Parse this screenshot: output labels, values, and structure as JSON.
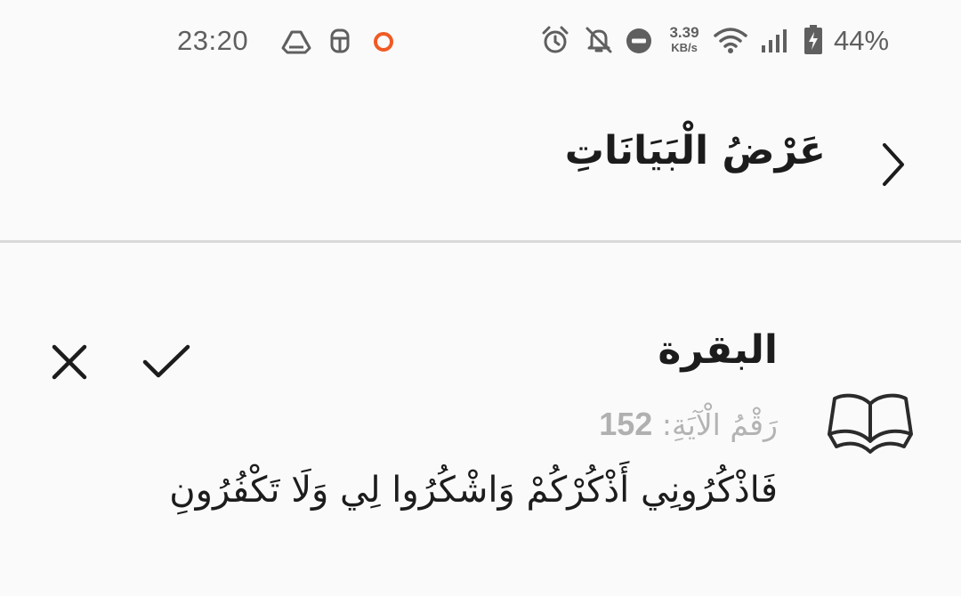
{
  "status_bar": {
    "time": "23:20",
    "net_speed_value": "3.39",
    "net_speed_unit": "KB/s",
    "battery_percent": "44%",
    "icons": [
      "drive-icon",
      "bug-icon",
      "record-dot-icon",
      "alarm-icon",
      "notifications-off-icon",
      "do-not-disturb-icon",
      "wifi-icon",
      "signal-icon",
      "battery-charging-icon"
    ],
    "record_color": "#f15a24"
  },
  "app_bar": {
    "title": "عَرْضُ الْبَيَانَاتِ",
    "back_icon": "chevron-right-icon"
  },
  "item": {
    "surah_name": "البقرة",
    "ayah_label": "رَقْمُ الْآيَةِ:",
    "ayah_number": "152",
    "ayah_text": "فَاذْكُرُونِي أَذْكُرْكُمْ وَاشْكُرُوا لِي وَلَا تَكْفُرُونِ",
    "icons": [
      "quran-book-icon",
      "confirm-icon",
      "close-icon"
    ]
  },
  "colors": {
    "background": "#fafafa",
    "text_primary": "#1c1c1c",
    "text_secondary": "#b3b3b3",
    "status_text": "#5f5f5f",
    "divider": "#d9d9d9"
  }
}
